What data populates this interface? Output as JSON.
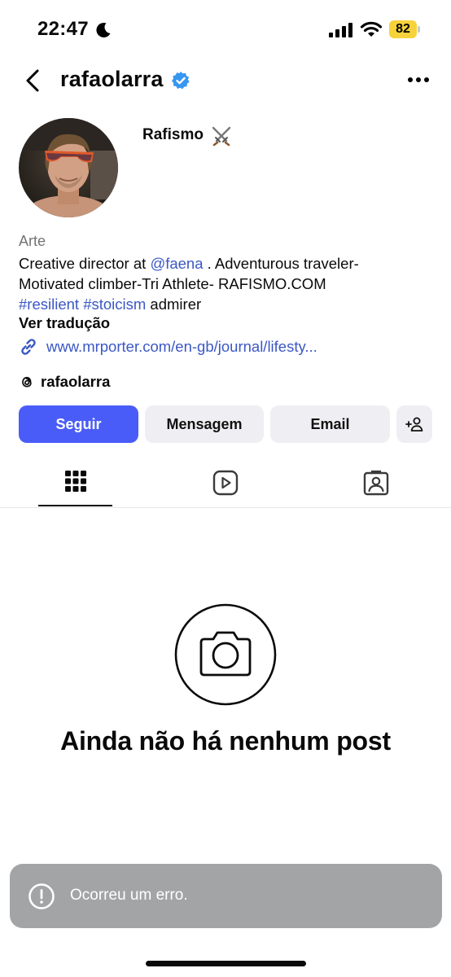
{
  "status_bar": {
    "time": "22:47",
    "battery": "82",
    "icons": [
      "moon-icon",
      "signal-icon",
      "wifi-icon",
      "battery-icon"
    ]
  },
  "header": {
    "username": "rafaolarra",
    "verified": true,
    "accent_color": "#3797f0"
  },
  "profile": {
    "display_name": "Rafismo",
    "display_name_icon": "crossed-swords-icon",
    "category": "Arte",
    "bio": {
      "line1_prefix": "Creative director at ",
      "mention": "@faena",
      "line1_suffix": " . Adventurous traveler-",
      "line2": "Motivated climber-Tri Athlete- RAFISMO.COM",
      "hashtag1": "#resilient",
      "hashtag2": "#stoicism",
      "line3_suffix": " admirer"
    },
    "translate_label": "Ver tradução",
    "website": "www.mrporter.com/en-gb/journal/lifesty...",
    "threads_handle": "rafaolarra",
    "link_color": "#3b58c4"
  },
  "actions": {
    "follow": "Seguir",
    "message": "Mensagem",
    "email": "Email",
    "follow_color": "#4a5cf8"
  },
  "tabs": [
    {
      "name": "posts",
      "icon": "grid-icon",
      "active": true
    },
    {
      "name": "reels",
      "icon": "reels-icon",
      "active": false
    },
    {
      "name": "tagged",
      "icon": "tagged-icon",
      "active": false
    }
  ],
  "empty_state": {
    "icon": "camera-icon",
    "title": "Ainda não há nenhum post"
  },
  "toast": {
    "icon": "alert-icon",
    "message": "Ocorreu um erro."
  }
}
